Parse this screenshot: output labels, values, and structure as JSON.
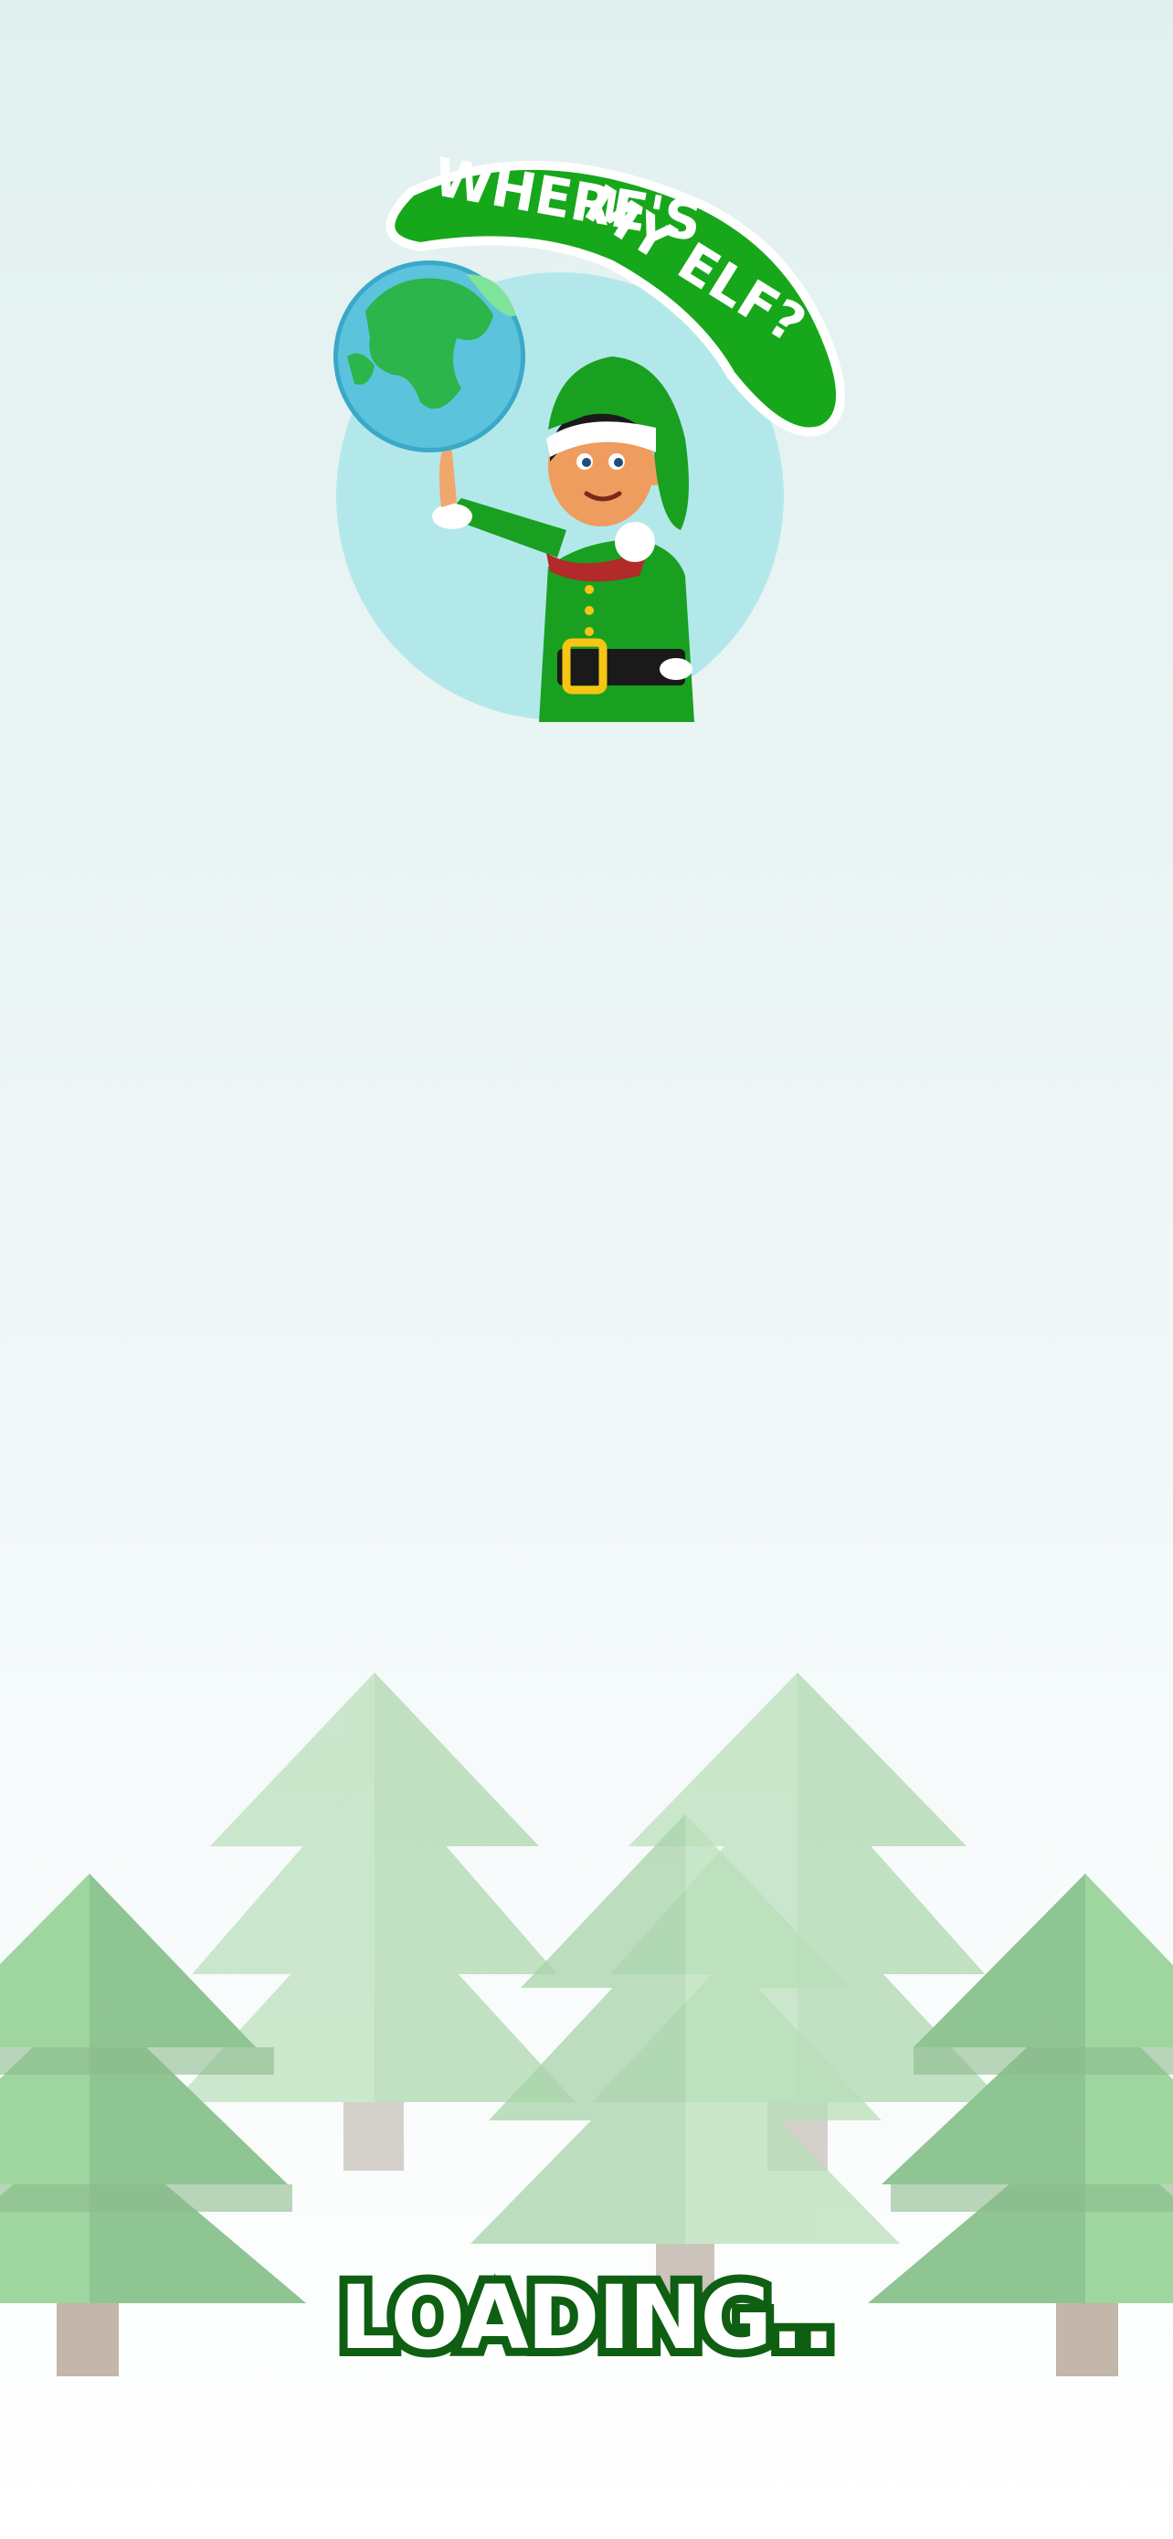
{
  "game": {
    "title_line1": "WHERE'S",
    "title_line2": "MY ELF?",
    "loading_text": "LOADING..",
    "icons": {
      "globe": "globe-icon",
      "elf": "elf-character"
    },
    "colors": {
      "brand_green": "#16a71a",
      "dark_green": "#0e5f12",
      "circle_bg": "#b3e8ea",
      "belt_buckle": "#f7c513"
    }
  }
}
